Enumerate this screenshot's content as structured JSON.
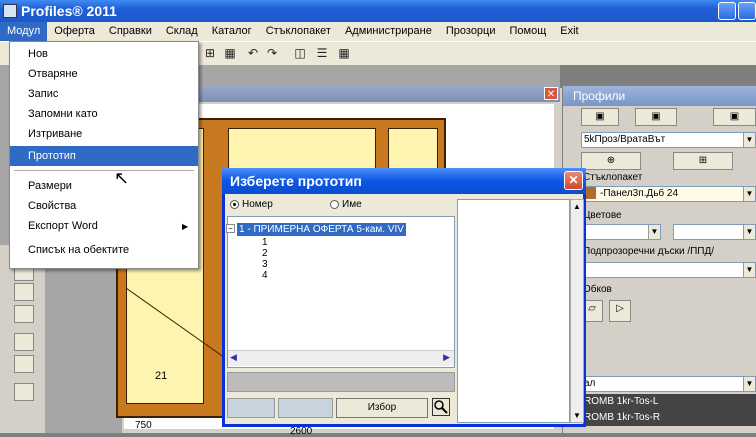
{
  "window": {
    "title": "Profiles® 2011"
  },
  "menubar": [
    "Модул",
    "Оферта",
    "Справки",
    "Склад",
    "Каталог",
    "Стъклопакет",
    "Администриране",
    "Прозорци",
    "Помощ",
    "Exit"
  ],
  "menu_dropdown": {
    "items": [
      "Нов",
      "Отваряне",
      "Запис",
      "Запомни като",
      "Изтриване",
      "Прототип",
      "Размери",
      "Свойства",
      "Експорт Word",
      "Списък на обектите"
    ],
    "highlighted": "Прототип"
  },
  "dialog": {
    "title": "Изберете прототип",
    "radio_number": "Номер",
    "radio_name": "Име",
    "tree_root": "1 - ПРИМЕРНА ОФЕРТА 5-кам. VIV",
    "tree_children": [
      "1",
      "2",
      "3",
      "4"
    ],
    "select_button": "Избор",
    "close_glyph": "✕"
  },
  "right_panel": {
    "title": "Профили",
    "profile_field": "5kПроз/ВратаВът",
    "glass_label": "Стъклопакет",
    "glass_field": "-Панел3п.Дьб 24",
    "colors_label": "Цветове",
    "sills_label": "Подпрозоречни дъски /ППД/",
    "kobs_label": "Обков",
    "list_items": [
      "ал",
      "ROMB 1kr-Tos-L",
      "ROMB 1kr-Tos-R"
    ]
  },
  "drawing": {
    "dim_left": "750",
    "dim_bottom": "2600",
    "pane_label": "21"
  }
}
